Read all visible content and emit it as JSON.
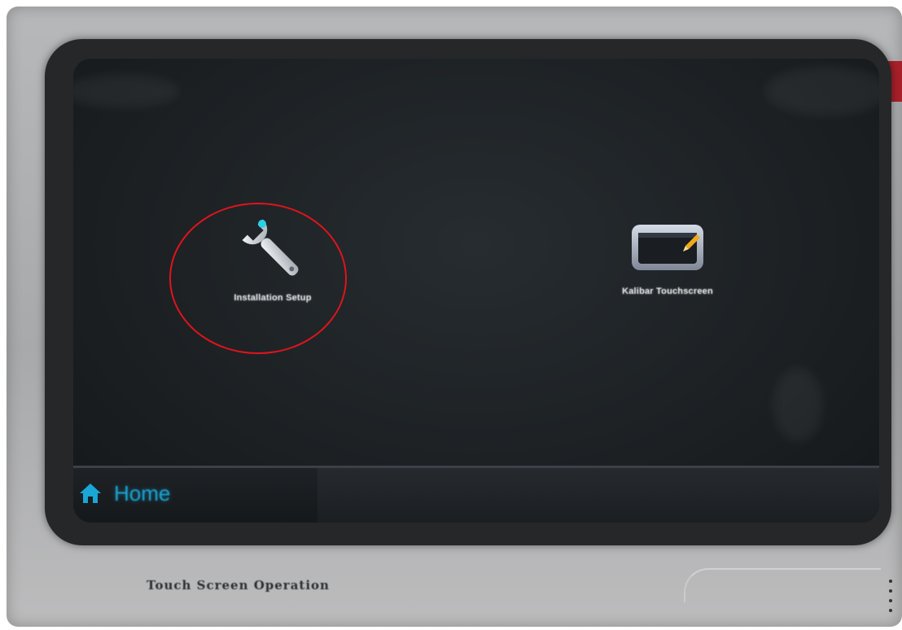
{
  "screen": {
    "icons": [
      {
        "name": "installation-setup",
        "label": "Installation Setup",
        "icon": "wrench-icon"
      },
      {
        "name": "calibrate-touchscreen",
        "label": "Kalibar Touchscreen",
        "icon": "touchscreen-icon"
      }
    ],
    "home_label": "Home"
  },
  "device_caption": "Touch Screen Operation",
  "colors": {
    "accent": "#1aa6d6",
    "highlight": "#e0141b",
    "screen_bg": "#1d2124",
    "bezel": "#262728",
    "frame": "#b0b1b3"
  }
}
